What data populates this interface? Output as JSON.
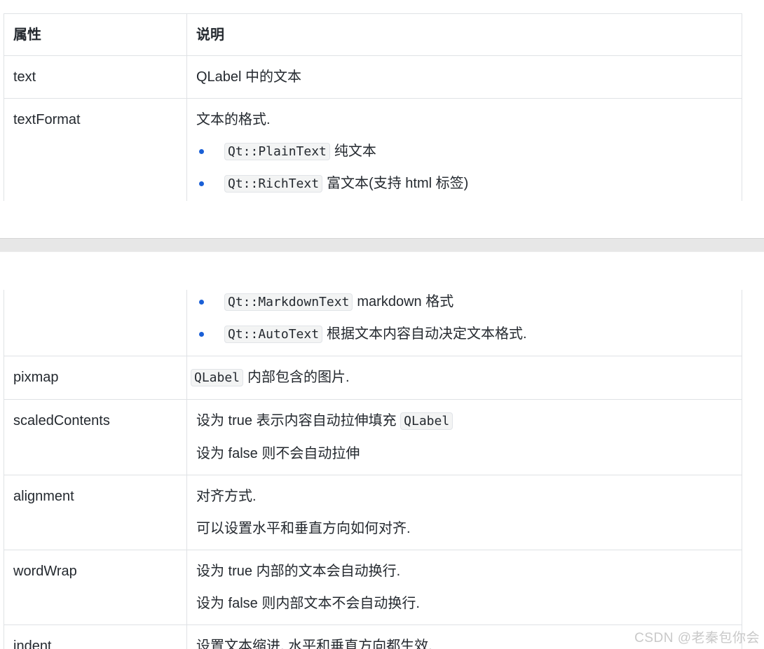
{
  "table": {
    "headers": [
      "属性",
      "说明"
    ],
    "rows": {
      "text": {
        "name": "text",
        "desc": "QLabel 中的文本"
      },
      "textFormat": {
        "name": "textFormat",
        "desc": "文本的格式.",
        "items": [
          {
            "code": "Qt::PlainText",
            "text": "纯文本"
          },
          {
            "code": "Qt::RichText",
            "text": "富文本(支持 html 标签)"
          },
          {
            "code": "Qt::MarkdownText",
            "text": "markdown 格式"
          },
          {
            "code": "Qt::AutoText",
            "text": "根据文本内容自动决定文本格式."
          }
        ]
      },
      "pixmap": {
        "name": "pixmap",
        "code": "QLabel",
        "desc": "内部包含的图片."
      },
      "scaledContents": {
        "name": "scaledContents",
        "line1": "设为 true 表示内容自动拉伸填充",
        "code": "QLabel",
        "line2": "设为 false 则不会自动拉伸"
      },
      "alignment": {
        "name": "alignment",
        "line1": "对齐方式.",
        "line2": "可以设置水平和垂直方向如何对齐."
      },
      "wordWrap": {
        "name": "wordWrap",
        "line1": "设为 true 内部的文本会自动换行.",
        "line2": "设为 false 则内部文本不会自动换行."
      },
      "indent": {
        "name": "indent",
        "desc": "设置文本缩进. 水平和垂直方向都生效."
      }
    }
  },
  "watermark": "CSDN @老秦包你会",
  "colors": {
    "bullet": "#1a5fd6",
    "border": "#dfe2e5",
    "separator": "#e7e7e7",
    "code_bg": "#f3f4f4"
  }
}
